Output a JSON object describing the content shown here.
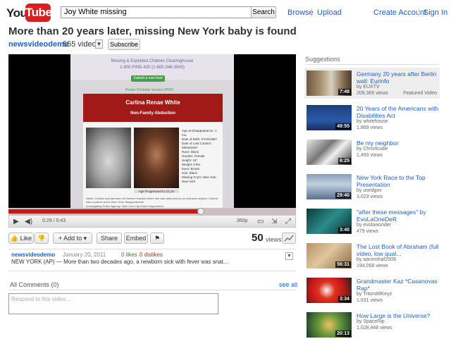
{
  "header": {
    "logo_you": "You",
    "logo_tube": "Tube",
    "search_value": "Joy White missing",
    "search_button": "Search",
    "browse": "Browse",
    "upload": "Upload",
    "create_account": "Create Account",
    "sign_in": "Sign In"
  },
  "video": {
    "title": "More than 20 years later, missing New York baby is found",
    "channel": "newsvideodemo",
    "video_count": "555 videos",
    "subscribe": "Subscribe",
    "time": "0:29 / 0:43",
    "quality": "360p",
    "progress": 0.67,
    "views_number": "50",
    "views_label": "views"
  },
  "frame": {
    "header_line1": "Missing & Exploited Children Clearinghouse",
    "header_line2": "1-800-FIND-420 (1-800-346-3543)",
    "submit_lead": "Submit a new lead",
    "poster_link": "Poster Printable Version (PDF)",
    "name": "Carlina Renae White",
    "case_type": "Non-Family Abduction",
    "info_lines": [
      "Age at Disappearance: 1 mo.",
      "Date of Birth: 07/15/1987",
      "Date of Last Contact: 08/04/1987",
      "Race: Black",
      "Gender: Female",
      "Height: 19\"",
      "Weight: 8 lbs.",
      "Eyes: Brown",
      "Hair: Black",
      "Missing From: New York, New York"
    ],
    "age_progressed": "Age Progressed to 22 yrs",
    "note": "Notes: Carlina was last seen at Harlem Hospital where she was abducted by an unknown subject. Carlina was a patient at the time of her disappearance.",
    "agency": "Investigating Police Agency: New York City Police Department"
  },
  "actions": {
    "like": "Like",
    "add_to": "Add to",
    "share": "Share",
    "embed": "Embed"
  },
  "info": {
    "channel": "newsvideodemo",
    "date": "January 20, 2011",
    "likes": "0 likes",
    "dislikes": "0 dislikes",
    "description": "NEW YORK (AP) — More than two decades ago, a newborn sick with fever was snat..."
  },
  "comments": {
    "header": "All Comments (0)",
    "see_all": "see all",
    "placeholder": "Respond to this video..."
  },
  "sidebar": {
    "header": "Suggestions",
    "items": [
      {
        "title": "Germany 20 years after Berlin wall: Eurinfo",
        "by": "by EUXTV",
        "views": "209,365 views",
        "duration": "7:48",
        "featured": "Featured Video"
      },
      {
        "title": "20 Years of the Americans with Disabilities Act",
        "by": "by whitehouse",
        "views": "1,869 views",
        "duration": "49:55"
      },
      {
        "title": "Be my neighbor",
        "by": "by ChrisIlcube",
        "views": "1,493 views",
        "duration": "6:25"
      },
      {
        "title": "New York Race to the Top Presentation",
        "by": "by usedgov",
        "views": "3,023 views",
        "duration": "29:40"
      },
      {
        "title": "\"after these messages\" by EvoLaOneDeR",
        "by": "by evolawonder",
        "views": "479 views",
        "duration": "3:40"
      },
      {
        "title": "The Lost Book of Abraham (full video, low qual...",
        "by": "by aaronshaf2006",
        "views": "194,058 views",
        "duration": "56:31"
      },
      {
        "title": "Grandmaster Kaz *Casanovas Rap*",
        "by": "by Triton88Keyz",
        "views": "1,631 views",
        "duration": "3:34"
      },
      {
        "title": "How Large is the Universe?",
        "by": "by SpaceRip",
        "views": "1,028,448 views",
        "duration": "20:13"
      }
    ]
  }
}
